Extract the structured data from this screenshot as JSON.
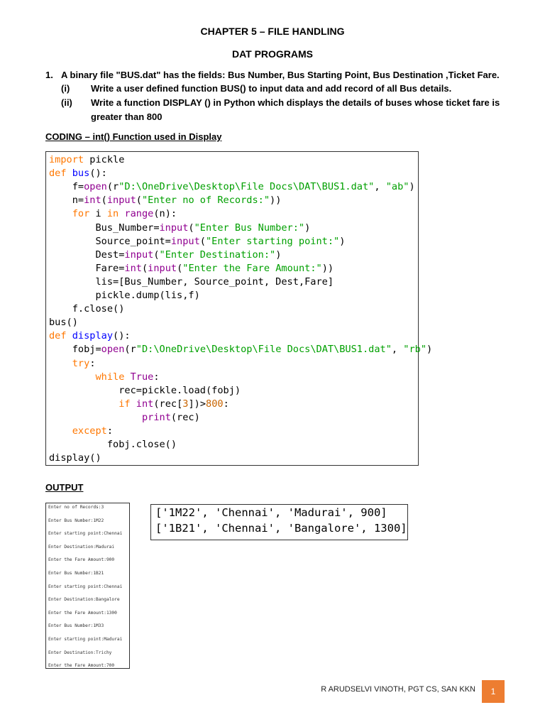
{
  "header": {
    "chapter": "CHAPTER 5 – FILE HANDLING",
    "subtitle": "DAT PROGRAMS"
  },
  "question": {
    "number": "1.",
    "text": "A binary file \"BUS.dat\" has the fields: Bus Number, Bus Starting Point, Bus Destination ,Ticket Fare.",
    "parts": [
      {
        "label": "(i)",
        "text": "Write a user defined function BUS() to input data and add record of all Bus details."
      },
      {
        "label": "(ii)",
        "text": "Write a function DISPLAY () in Python which displays the details of  buses whose ticket fare is",
        "text2": "greater than 800"
      }
    ]
  },
  "coding_heading": "CODING – int() Function used in Display",
  "code_lines": [
    [
      [
        "import",
        "kw"
      ],
      [
        " pickle",
        "pl"
      ]
    ],
    [
      [
        "def",
        "kw"
      ],
      [
        " ",
        "pl"
      ],
      [
        "bus",
        "fn"
      ],
      [
        "():",
        "pl"
      ]
    ],
    [
      [
        "    f=",
        "pl"
      ],
      [
        "open",
        "bi"
      ],
      [
        "(r",
        "pl"
      ],
      [
        "\"D:\\OneDrive\\Desktop\\File Docs\\DAT\\BUS1.dat\"",
        "st"
      ],
      [
        ", ",
        "pl"
      ],
      [
        "\"ab\"",
        "st"
      ],
      [
        ")",
        "pl"
      ]
    ],
    [
      [
        "    n=",
        "pl"
      ],
      [
        "int",
        "bi"
      ],
      [
        "(",
        "pl"
      ],
      [
        "input",
        "bi"
      ],
      [
        "(",
        "pl"
      ],
      [
        "\"Enter no of Records:\"",
        "st"
      ],
      [
        "))",
        "pl"
      ]
    ],
    [
      [
        "    ",
        "pl"
      ],
      [
        "for",
        "kw"
      ],
      [
        " i ",
        "pl"
      ],
      [
        "in",
        "kw"
      ],
      [
        " ",
        "pl"
      ],
      [
        "range",
        "bi"
      ],
      [
        "(n):",
        "pl"
      ]
    ],
    [
      [
        "        Bus_Number=",
        "pl"
      ],
      [
        "input",
        "bi"
      ],
      [
        "(",
        "pl"
      ],
      [
        "\"Enter Bus Number:\"",
        "st"
      ],
      [
        ")",
        "pl"
      ]
    ],
    [
      [
        "        Source_point=",
        "pl"
      ],
      [
        "input",
        "bi"
      ],
      [
        "(",
        "pl"
      ],
      [
        "\"Enter starting point:\"",
        "st"
      ],
      [
        ")",
        "pl"
      ]
    ],
    [
      [
        "        Dest=",
        "pl"
      ],
      [
        "input",
        "bi"
      ],
      [
        "(",
        "pl"
      ],
      [
        "\"Enter Destination:\"",
        "st"
      ],
      [
        ")",
        "pl"
      ]
    ],
    [
      [
        "        Fare=",
        "pl"
      ],
      [
        "int",
        "bi"
      ],
      [
        "(",
        "pl"
      ],
      [
        "input",
        "bi"
      ],
      [
        "(",
        "pl"
      ],
      [
        "\"Enter the Fare Amount:\"",
        "st"
      ],
      [
        "))",
        "pl"
      ]
    ],
    [
      [
        "        lis=[Bus_Number, Source_point, Dest,Fare]",
        "pl"
      ]
    ],
    [
      [
        "        pickle.dump(lis,f)",
        "pl"
      ]
    ],
    [
      [
        "    f.close()",
        "pl"
      ]
    ],
    [
      [
        "bus()",
        "pl"
      ]
    ],
    [
      [
        "def",
        "kw"
      ],
      [
        " ",
        "pl"
      ],
      [
        "display",
        "fn"
      ],
      [
        "():",
        "pl"
      ]
    ],
    [
      [
        "    fobj=",
        "pl"
      ],
      [
        "open",
        "bi"
      ],
      [
        "(r",
        "pl"
      ],
      [
        "\"D:\\OneDrive\\Desktop\\File Docs\\DAT\\BUS1.dat\"",
        "st"
      ],
      [
        ", ",
        "pl"
      ],
      [
        "\"rb\"",
        "st"
      ],
      [
        ")",
        "pl"
      ]
    ],
    [
      [
        "    ",
        "pl"
      ],
      [
        "try",
        "kw"
      ],
      [
        ":",
        "pl"
      ]
    ],
    [
      [
        "        ",
        "pl"
      ],
      [
        "while",
        "kw"
      ],
      [
        " ",
        "pl"
      ],
      [
        "True",
        "bi"
      ],
      [
        ":",
        "pl"
      ]
    ],
    [
      [
        "            rec=pickle.load(fobj)",
        "pl"
      ]
    ],
    [
      [
        "            ",
        "pl"
      ],
      [
        "if",
        "kw"
      ],
      [
        " ",
        "pl"
      ],
      [
        "int",
        "bi"
      ],
      [
        "(rec[",
        "pl"
      ],
      [
        "3",
        "nm"
      ],
      [
        "])>",
        "pl"
      ],
      [
        "800",
        "nm"
      ],
      [
        ":",
        "pl"
      ]
    ],
    [
      [
        "                ",
        "pl"
      ],
      [
        "print",
        "bi"
      ],
      [
        "(rec)",
        "pl"
      ]
    ],
    [
      [
        "    ",
        "pl"
      ],
      [
        "except",
        "kw"
      ],
      [
        ":",
        "pl"
      ]
    ],
    [
      [
        "          fobj.close()",
        "pl"
      ]
    ],
    [
      [
        "display()",
        "pl"
      ]
    ]
  ],
  "output_heading": "OUTPUT",
  "console_lines": [
    "Enter no of Records:3",
    "Enter Bus Number:1M22",
    "Enter starting point:Chennai",
    "Enter Destination:Madurai",
    "Enter the Fare Amount:900",
    "Enter Bus Number:1B21",
    "Enter starting point:Chennai",
    "Enter Destination:Bangalore",
    "Enter the Fare Amount:1300",
    "Enter Bus Number:1M33",
    "Enter starting point:Madurai",
    "Enter Destination:Trichy",
    "Enter the Fare Amount:700"
  ],
  "result_lines": [
    "['1M22', 'Chennai', 'Madurai', 900]",
    "['1B21', 'Chennai', 'Bangalore', 1300]"
  ],
  "footer": {
    "author": "R ARUDSELVI VINOTH, PGT CS, SAN KKN",
    "page": "1",
    "page_color": "#ed7d31"
  }
}
